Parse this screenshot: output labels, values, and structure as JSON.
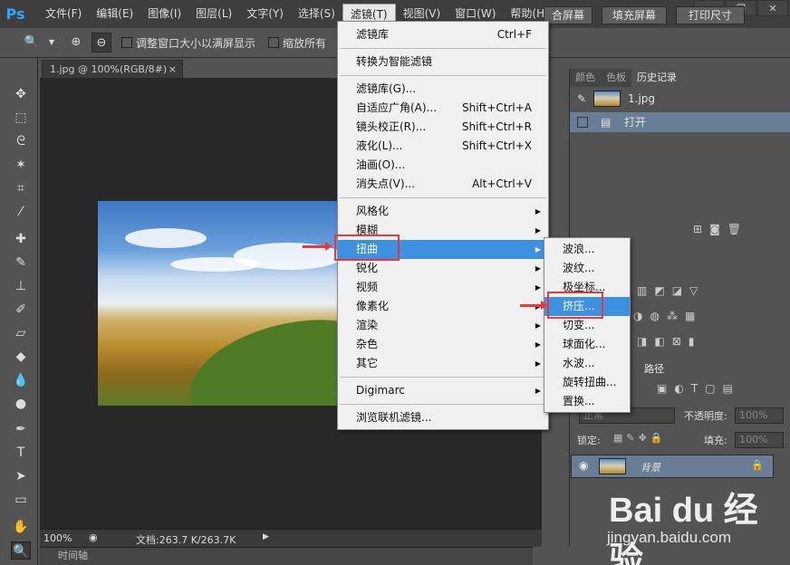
{
  "app": {
    "logo": "Ps"
  },
  "menubar": {
    "items": [
      "文件(F)",
      "编辑(E)",
      "图像(I)",
      "图层(L)",
      "文字(Y)",
      "选择(S)",
      "滤镜(T)",
      "视图(V)",
      "窗口(W)",
      "帮助(H)"
    ],
    "active": "滤镜(T)",
    "window_controls": [
      "—",
      "❐",
      "✕"
    ]
  },
  "options_bar": {
    "checkbox1_label": "调整窗口大小以满屏显示",
    "checkbox2_label": "缩放所有",
    "btn_fill_partial": "合屏幕",
    "btn_fill_screen": "填充屏幕",
    "btn_print_size": "打印尺寸"
  },
  "document": {
    "tab_title": "1.jpg @ 100%(RGB/8#)",
    "tab_close": "×",
    "zoom": "100%",
    "doc_info": "文档:263.7 K/263.7K",
    "timeline_label": "时间轴"
  },
  "panels": {
    "tabs": [
      "颜色",
      "色板",
      "历史记录"
    ],
    "active_tab": "历史记录",
    "history_snapshot": "1.jpg",
    "history_items": [
      "打开"
    ],
    "layers_tab_partial": "路径",
    "blend_mode": "正常",
    "opacity_label": "不透明度:",
    "opacity_value": "100%",
    "lock_label": "锁定:",
    "fill_label": "填充:",
    "fill_value": "100%",
    "layer_name": "背景"
  },
  "filter_menu": {
    "items": [
      {
        "label": "滤镜库",
        "shortcut": "Ctrl+F"
      },
      {
        "label": "转换为智能滤镜",
        "shortcut": ""
      },
      {
        "label": "滤镜库(G)...",
        "shortcut": ""
      },
      {
        "label": "自适应广角(A)...",
        "shortcut": "Shift+Ctrl+A"
      },
      {
        "label": "镜头校正(R)...",
        "shortcut": "Shift+Ctrl+R"
      },
      {
        "label": "液化(L)...",
        "shortcut": "Shift+Ctrl+X"
      },
      {
        "label": "油画(O)...",
        "shortcut": ""
      },
      {
        "label": "消失点(V)...",
        "shortcut": "Alt+Ctrl+V"
      },
      {
        "label": "风格化",
        "shortcut": ""
      },
      {
        "label": "模糊",
        "shortcut": ""
      },
      {
        "label": "扭曲",
        "shortcut": ""
      },
      {
        "label": "锐化",
        "shortcut": ""
      },
      {
        "label": "视频",
        "shortcut": ""
      },
      {
        "label": "像素化",
        "shortcut": ""
      },
      {
        "label": "渲染",
        "shortcut": ""
      },
      {
        "label": "杂色",
        "shortcut": ""
      },
      {
        "label": "其它",
        "shortcut": ""
      },
      {
        "label": "Digimarc",
        "shortcut": ""
      },
      {
        "label": "浏览联机滤镜...",
        "shortcut": ""
      }
    ],
    "highlighted": "扭曲"
  },
  "distort_submenu": {
    "items": [
      "波浪...",
      "波纹...",
      "极坐标...",
      "挤压...",
      "切变...",
      "球面化...",
      "水波...",
      "旋转扭曲...",
      "置换..."
    ],
    "highlighted": "挤压..."
  },
  "watermark": {
    "logo": "Bai du 经验",
    "url": "jingyan.baidu.com"
  },
  "colors": {
    "highlight": "#3d91e0",
    "annotation": "#e53a3a",
    "ps_blue": "#31a8ff"
  }
}
